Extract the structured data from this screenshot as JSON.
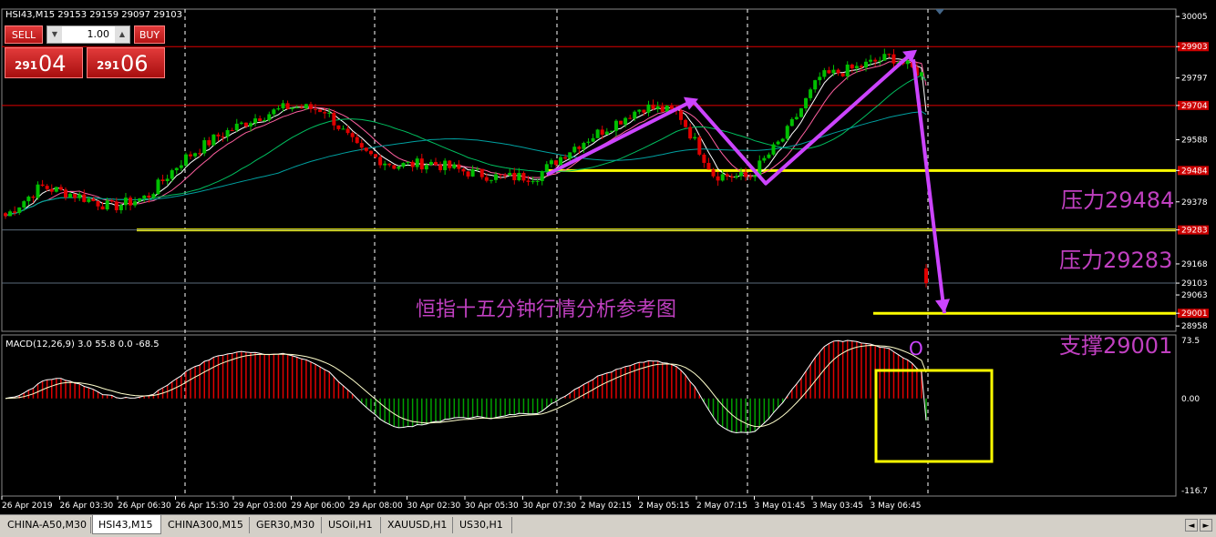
{
  "chart_header": "HSI43,M15  29153 29159 29097 29103",
  "trade_panel": {
    "sell_label": "SELL",
    "buy_label": "BUY",
    "lot": "1.00",
    "sell_small": "291",
    "sell_big": "04",
    "buy_small": "291",
    "buy_big": "06"
  },
  "price_axis_labels": [
    "30005",
    "29903",
    "29797",
    "29704",
    "29588",
    "29484",
    "29378",
    "29283",
    "29168",
    "29103",
    "29063",
    "29001",
    "28958"
  ],
  "time_axis_labels": [
    "26 Apr 2019",
    "26 Apr 03:30",
    "26 Apr 06:30",
    "26 Apr 15:30",
    "29 Apr 03:00",
    "29 Apr 06:00",
    "29 Apr 08:00",
    "30 Apr 02:30",
    "30 Apr 05:30",
    "30 Apr 07:30",
    "2 May 02:15",
    "2 May 05:15",
    "2 May 07:15",
    "3 May 01:45",
    "3 May 03:45",
    "3 May 06:45"
  ],
  "annotations": {
    "title": "恒指十五分钟行情分析参考图",
    "resistance_1": "压力29484",
    "resistance_2": "压力29283",
    "support": "支撑29001",
    "circle_mark": "O"
  },
  "macd": {
    "header": "MACD(12,26,9) 3.0 55.8 0.0 -68.5",
    "axis_labels": [
      "73.5",
      "0.00",
      "-116.7"
    ]
  },
  "tabs": [
    "CHINA-A50,M30",
    "HSI43,M15",
    "CHINA300,M15",
    "GER30,M30",
    "USOil,H1",
    "XAUUSD,H1",
    "US30,H1"
  ],
  "active_tab": "HSI43,M15",
  "colors": {
    "background": "#000000",
    "bull_candle": "#00c000",
    "bear_candle": "#e00000",
    "support_line": "#ffff00",
    "resistance_line": "#e00000",
    "arrow": "#cc44ff",
    "annotation_text": "#c040c0",
    "macd_pos": "#e00000",
    "macd_neg": "#00a000",
    "signal": "#ffffcc"
  },
  "chart_data": {
    "type": "candlestick",
    "title": "恒指十五分钟行情分析参考图",
    "symbol": "HSI43",
    "timeframe": "M15",
    "ohlc_last": {
      "open": 29153,
      "high": 29159,
      "low": 29097,
      "close": 29103
    },
    "ylim": [
      28940,
      30030
    ],
    "x": [
      "26 Apr 2019",
      "26 Apr 03:30",
      "26 Apr 06:30",
      "26 Apr 15:30",
      "29 Apr 03:00",
      "29 Apr 06:00",
      "29 Apr 08:00",
      "30 Apr 02:30",
      "30 Apr 05:30",
      "30 Apr 07:30",
      "2 May 02:15",
      "2 May 05:15",
      "2 May 07:15",
      "3 May 01:45",
      "3 May 03:45",
      "3 May 06:45"
    ],
    "close_path": [
      29330,
      29430,
      29400,
      29360,
      29395,
      29520,
      29600,
      29660,
      29700,
      29690,
      29550,
      29500,
      29510,
      29480,
      29460,
      29465,
      29560,
      29630,
      29700,
      29680,
      29470,
      29460,
      29600,
      29800,
      29830,
      29870,
      29800,
      29103
    ],
    "horizontal_levels": [
      {
        "value": 29484,
        "label": "压力29484",
        "color": "#ffff00"
      },
      {
        "value": 29283,
        "label": "压力29283",
        "color": "#ffff00"
      },
      {
        "value": 29001,
        "label": "支撑29001",
        "color": "#ffff00"
      },
      {
        "value": 29704,
        "color": "#e00000"
      },
      {
        "value": 29903,
        "color": "#e00000"
      }
    ],
    "macd": {
      "fast": 12,
      "slow": 26,
      "signal": 9,
      "values": [
        3.0,
        55.8,
        0.0,
        -68.5
      ],
      "ylim": [
        -116.7,
        73.5
      ]
    }
  }
}
